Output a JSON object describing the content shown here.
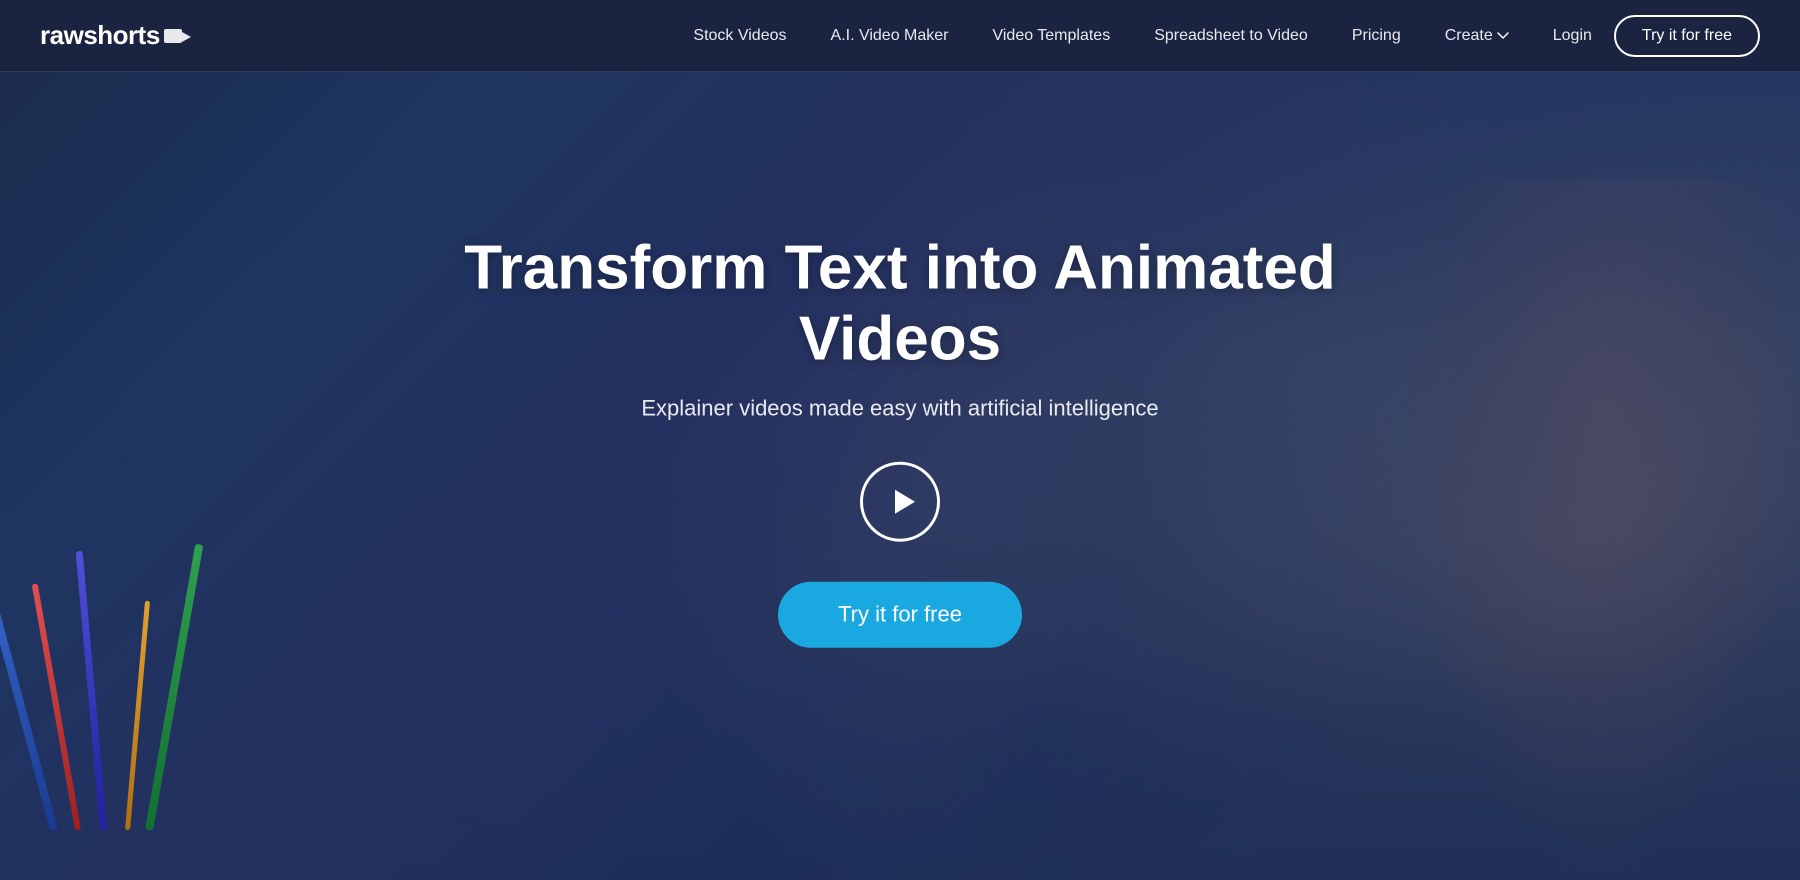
{
  "brand": {
    "name_part1": "raw",
    "name_part2": "shorts"
  },
  "navbar": {
    "links": [
      {
        "id": "stock-videos",
        "label": "Stock Videos"
      },
      {
        "id": "ai-video-maker",
        "label": "A.I. Video Maker"
      },
      {
        "id": "video-templates",
        "label": "Video Templates"
      },
      {
        "id": "spreadsheet-to-video",
        "label": "Spreadsheet to Video"
      },
      {
        "id": "pricing",
        "label": "Pricing"
      },
      {
        "id": "create",
        "label": "Create"
      }
    ],
    "login_label": "Login",
    "try_free_label": "Try it for free"
  },
  "hero": {
    "title": "Transform Text into Animated Videos",
    "subtitle": "Explainer videos made easy with artificial intelligence",
    "try_free_label": "Try it for free"
  },
  "colors": {
    "nav_bg": "#1a2340",
    "accent_blue": "#1aa8e0",
    "white": "#ffffff"
  }
}
